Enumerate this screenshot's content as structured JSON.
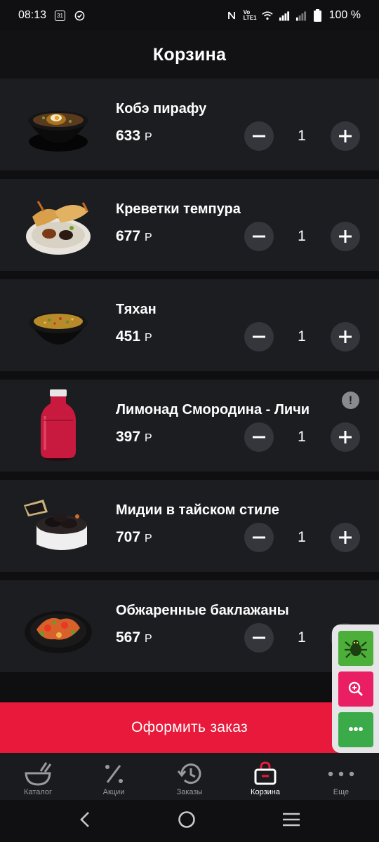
{
  "status_bar": {
    "time": "08:13",
    "calendar_day": "31",
    "battery": "100 %",
    "network_label": "Vo LTE1"
  },
  "header": {
    "title": "Корзина"
  },
  "cart": {
    "currency": "Р",
    "items": [
      {
        "name": "Кобэ пирафу",
        "price": "633",
        "qty": "1",
        "image": "bowl-rice-egg"
      },
      {
        "name": "Креветки темпура",
        "price": "677",
        "qty": "1",
        "image": "tempura-shrimp-plate"
      },
      {
        "name": "Тяхан",
        "price": "451",
        "qty": "1",
        "image": "fried-rice-bowl"
      },
      {
        "name": "Лимонад Смородина - Личи",
        "price": "397",
        "qty": "1",
        "image": "lemonade-bottle",
        "warning": "!"
      },
      {
        "name": "Мидии в тайском стиле",
        "price": "707",
        "qty": "1",
        "image": "mussels-bowl"
      },
      {
        "name": "Обжаренные баклажаны",
        "price": "567",
        "qty": "1",
        "image": "eggplant-plate"
      }
    ]
  },
  "checkout": {
    "label": "Оформить заказ"
  },
  "side_panel": {
    "more_label": "•••"
  },
  "bottom_nav": {
    "items": [
      {
        "label": "Каталог",
        "icon": "bowl-icon"
      },
      {
        "label": "Акции",
        "icon": "percent-icon"
      },
      {
        "label": "Заказы",
        "icon": "history-icon"
      },
      {
        "label": "Корзина",
        "icon": "cart-bag-icon",
        "active": true
      },
      {
        "label": "Еще",
        "icon": "more-dots-icon"
      }
    ]
  },
  "colors": {
    "accent": "#e8193a",
    "background": "#0f0f11",
    "card": "#1c1d21",
    "button": "#35363b"
  }
}
